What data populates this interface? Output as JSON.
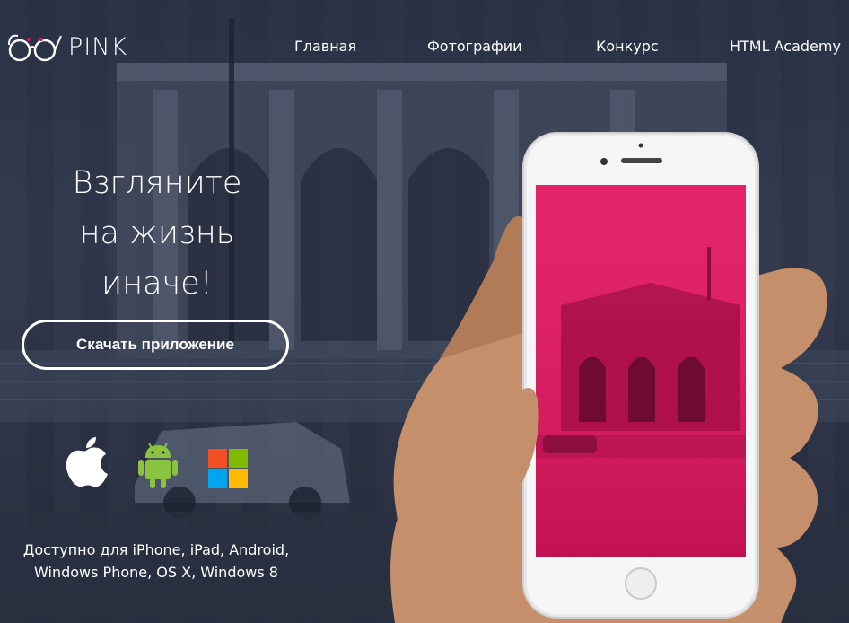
{
  "brand": {
    "logo_text": "PINK",
    "logo_icon": "glasses-logo-icon"
  },
  "nav": {
    "items": [
      {
        "label": "Главная"
      },
      {
        "label": "Фотографии"
      },
      {
        "label": "Конкурс"
      },
      {
        "label": "HTML Academy"
      }
    ]
  },
  "hero": {
    "headline_lines": [
      "Взгляните",
      "на жизнь",
      "иначе!"
    ],
    "download_button": "Скачать приложение",
    "availability_lines": [
      "Доступно для iPhone, iPad, Android,",
      "Windows Phone, OS X, Windows 8"
    ]
  },
  "platforms": [
    {
      "name": "apple-icon"
    },
    {
      "name": "android-icon",
      "color": "#8ac43f"
    },
    {
      "name": "windows-icon",
      "colors": [
        "#f25022",
        "#7fba00",
        "#00a4ef",
        "#ffb900"
      ]
    }
  ],
  "colors": {
    "accent": "#e2145e",
    "overlay": "#2c3445",
    "text": "#ffffff"
  }
}
